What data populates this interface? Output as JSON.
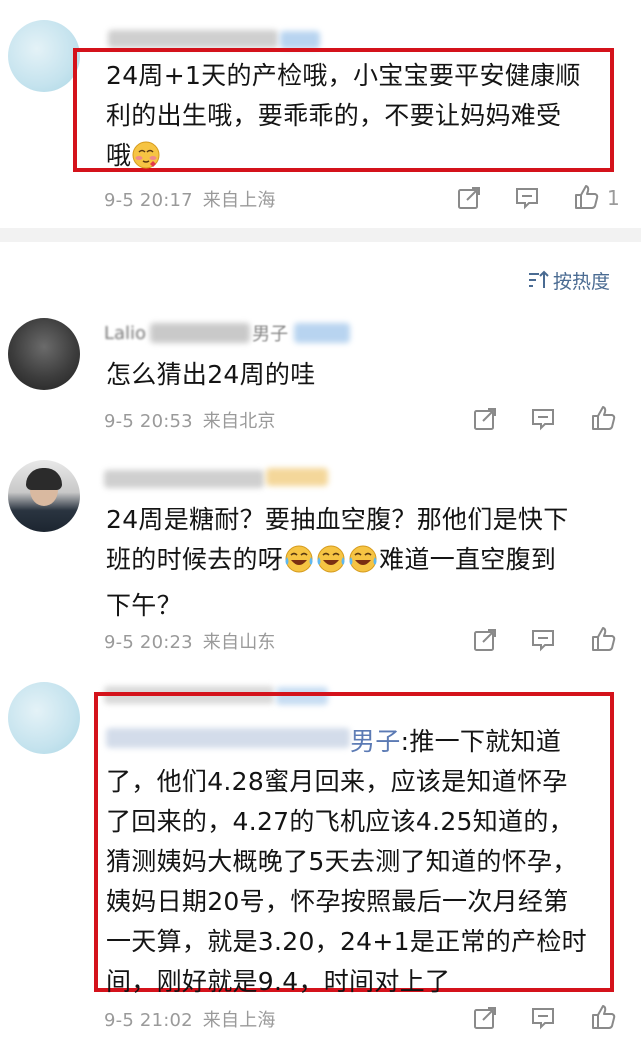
{
  "sort": {
    "label": "按热度"
  },
  "comments": [
    {
      "text": "24周+1天的产检哦，小宝宝要平安健康顺利的出生哦，要乖乖的，不要让妈妈难受哦",
      "lines": [
        "24周+1天的产检哦，小宝宝要平安健康顺",
        "利的出生哦，要乖乖的，不要让妈妈难受",
        "哦"
      ],
      "time": "9-5 20:17",
      "location": "来自上海",
      "like_count": "1"
    },
    {
      "username_visible": "Lalio",
      "username_hint": "男子",
      "text": "怎么猜出24周的哇",
      "lines": [
        "怎么猜出24周的哇"
      ],
      "time": "9-5 20:53",
      "location": "来自北京"
    },
    {
      "text": "24周是糖耐？要抽血空腹？那他们是快下班的时候去的呀😂😂😂难道一直空腹到下午？",
      "lines": [
        "24周是糖耐？要抽血空腹？那他们是快下",
        "班的时候去的呀",
        "难道一直空腹到",
        "下午？"
      ],
      "time": "9-5 20:23",
      "location": "来自山东"
    },
    {
      "mention": "男子",
      "text": ":推一下就知道了，他们4.28蜜月回来，应该是知道怀孕了回来的，4.27的飞机应该4.25知道的，猜测姨妈大概晚了5天去测了知道的怀孕，姨妈日期20号，怀孕按照最后一次月经第一天算，就是3.20，24+1是正常的产检时间，刚好就是9.4，时间对上了",
      "lines": [
        ":推一下就知道",
        "了，他们4.28蜜月回来，应该是知道怀孕",
        "了回来的，4.27的飞机应该4.25知道的，",
        "猜测姨妈大概晚了5天去测了知道的怀孕，",
        "姨妈日期20号，怀孕按照最后一次月经第",
        "一天算，就是3.20，24+1是正常的产检时",
        "间，刚好就是9.4，时间对上了"
      ],
      "time": "9-5 21:02",
      "location": "来自上海"
    }
  ],
  "colors": {
    "highlight": "#d4121b",
    "meta": "#9a9a9a",
    "icon": "#8a8a8a",
    "mention": "#5b7ab4",
    "divider": "#f2f2f2"
  },
  "icons": [
    "share-icon",
    "comment-icon",
    "like-icon",
    "sort-icon",
    "laugh-cry-emoji",
    "blush-emoji"
  ]
}
